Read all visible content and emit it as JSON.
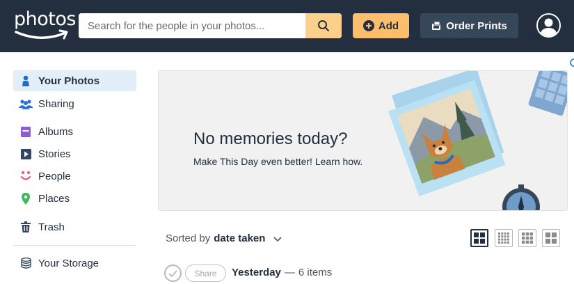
{
  "header": {
    "logo_text": "photos",
    "search_placeholder": "Search for the people in your photos...",
    "add_label": "Add",
    "order_prints_label": "Order Prints",
    "colors": {
      "bar": "#232f3e",
      "accent": "#fbbe6c",
      "search_button": "#fbd08b",
      "prints_button": "#37475a"
    }
  },
  "sidebar": {
    "items": [
      {
        "label": "Your Photos",
        "icon": "person-icon",
        "active": true
      },
      {
        "label": "Sharing",
        "icon": "people-group-icon"
      },
      {
        "label": "Albums",
        "icon": "album-icon"
      },
      {
        "label": "Stories",
        "icon": "play-icon"
      },
      {
        "label": "People",
        "icon": "face-icon"
      },
      {
        "label": "Places",
        "icon": "location-pin-icon"
      },
      {
        "label": "Trash",
        "icon": "trash-icon"
      },
      {
        "label": "Your Storage",
        "icon": "database-icon"
      }
    ]
  },
  "banner": {
    "title": "No memories today?",
    "subtitle": "Make This Day even better! Learn how."
  },
  "toolbar": {
    "sorted_prefix": "Sorted by",
    "sorted_value": "date taken",
    "view_modes": [
      "large-grid-icon",
      "small-grid-icon",
      "medium-grid-icon",
      "square-grid-icon"
    ]
  },
  "group": {
    "day": "Yesterday",
    "separator": "—",
    "count": "6 items",
    "share_label": "Share"
  }
}
